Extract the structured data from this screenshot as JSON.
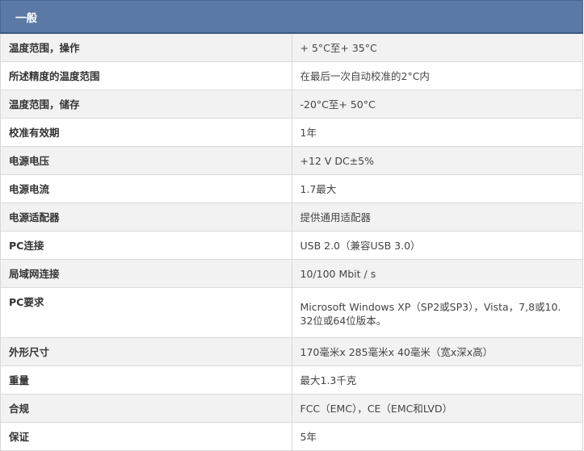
{
  "header": {
    "title": "一般"
  },
  "rows": [
    {
      "label": "温度范围，操作",
      "value": "+ 5°C至+ 35°C"
    },
    {
      "label": "所述精度的温度范围",
      "value": "在最后一次自动校准的2°C内"
    },
    {
      "label": "温度范围，储存",
      "value": "-20°C至+ 50°C"
    },
    {
      "label": "校准有效期",
      "value": "1年"
    },
    {
      "label": "电源电压",
      "value": "+12 V DC±5%"
    },
    {
      "label": "电源电流",
      "value": "1.7最大"
    },
    {
      "label": "电源适配器",
      "value": "提供通用适配器"
    },
    {
      "label": "PC连接",
      "value": "USB 2.0（兼容USB 3.0）"
    },
    {
      "label": "局域网连接",
      "value": "10/100 Mbit / s"
    },
    {
      "label": "PC要求",
      "value_lines": [
        "Microsoft Windows XP（SP2或SP3），Vista，7,8或10.",
        "32位或64位版本。"
      ]
    },
    {
      "label": "外形尺寸",
      "value": "170毫米x 285毫米x 40毫米（宽x深x高）"
    },
    {
      "label": "重量",
      "value": "最大1.3千克"
    },
    {
      "label": "合规",
      "value": "FCC（EMC），CE（EMC和LVD）"
    },
    {
      "label": "保证",
      "value": "5年"
    }
  ]
}
